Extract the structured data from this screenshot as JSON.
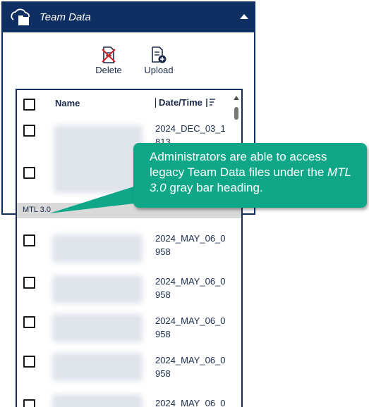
{
  "panel": {
    "title": "Team Data",
    "toolbar": {
      "delete_label": "Delete",
      "upload_label": "Upload"
    }
  },
  "list": {
    "headers": {
      "name": "Name",
      "date": "Date/Time"
    },
    "group_label": "MTL 3.0",
    "top_rows": [
      {
        "date": "2024_DEC_03_1813"
      },
      {
        "date": ""
      }
    ],
    "group_rows": [
      {
        "date": "2024_MAY_06_0958"
      },
      {
        "date": "2024_MAY_06_0958"
      },
      {
        "date": "2024_MAY_06_0958"
      },
      {
        "date": "2024_MAY_06_0958"
      },
      {
        "date": "2024_MAY_06_0"
      }
    ]
  },
  "callout": {
    "text_before": "Administrators are able to access legacy Team Data files under the ",
    "text_emphasis": "MTL 3.0",
    "text_after": " gray bar heading."
  },
  "colors": {
    "header_bg": "#0f2f63",
    "callout_bg": "#0fa788",
    "group_bar_bg": "#d9d9d9"
  }
}
